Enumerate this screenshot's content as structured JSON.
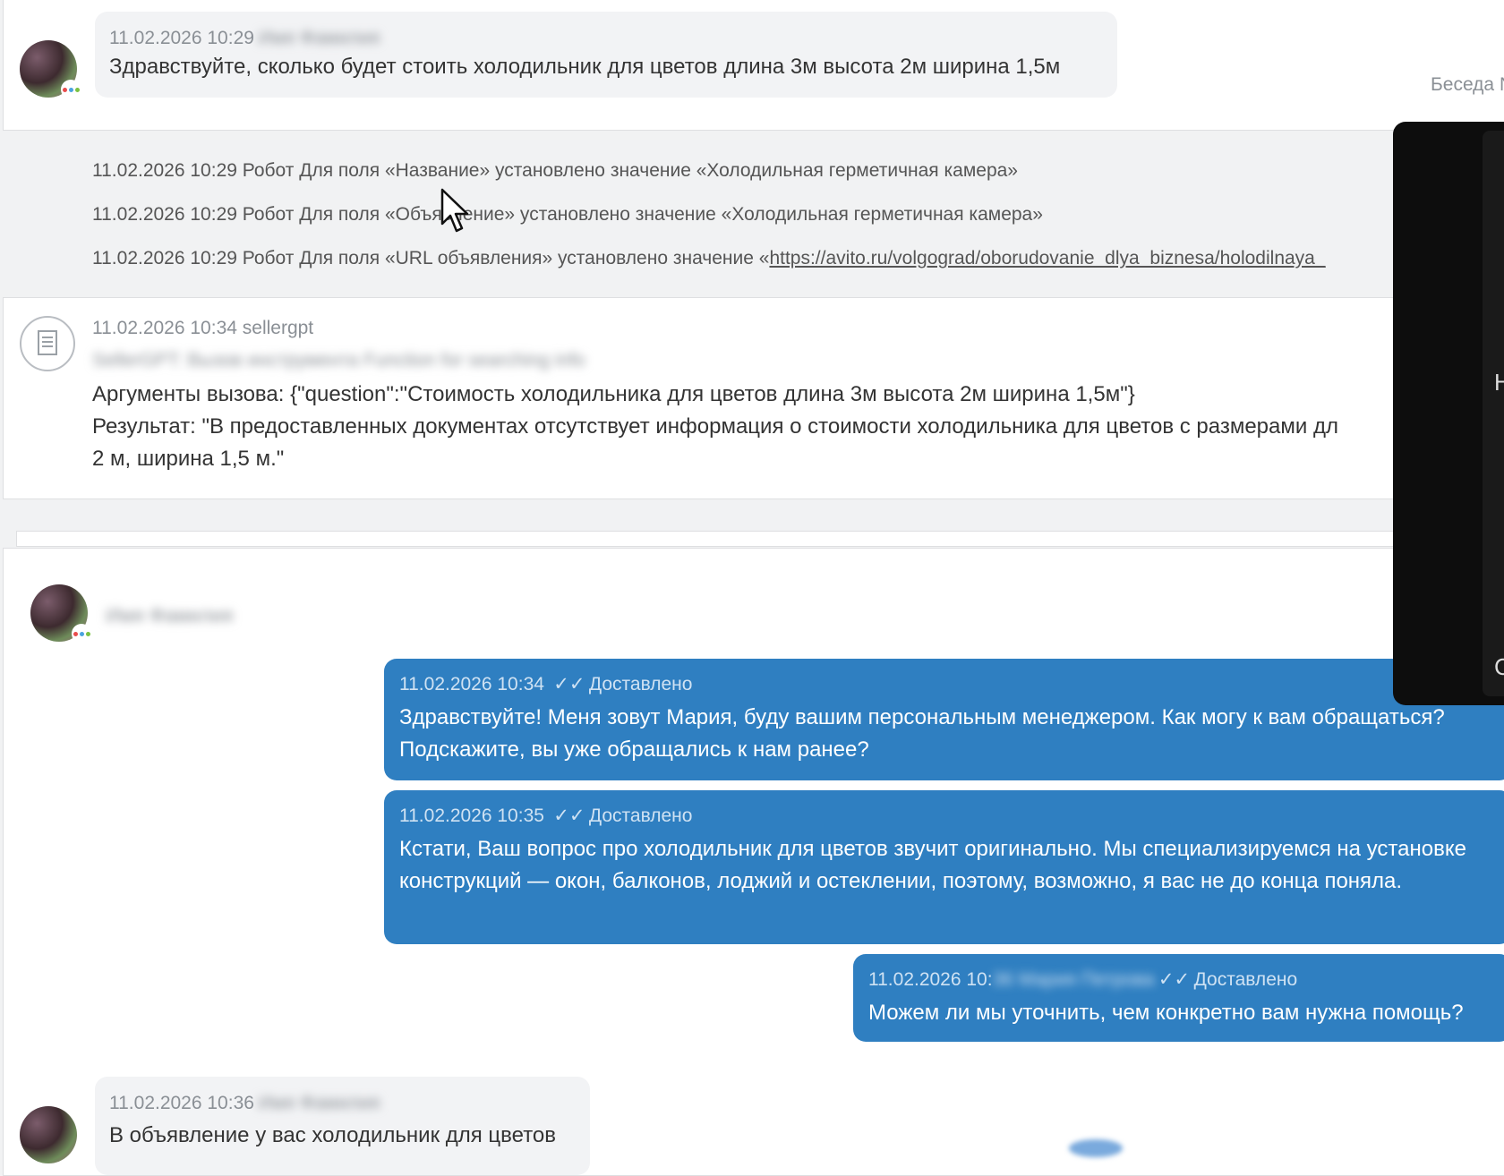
{
  "conversation_label": "Беседа N",
  "messages": [
    {
      "time": "11.02.2026 10:29",
      "author": "Имя Фамилия",
      "text": "Здравствуйте, сколько будет стоить холодильник для цветов длина 3м высота 2м ширина 1,5м"
    },
    {
      "time": "11.02.2026 10:36",
      "author": "Имя Фамилия",
      "text": "В объявление у вас холодильник для цветов"
    }
  ],
  "robot_log": [
    {
      "prefix": "11.02.2026 10:29 Робот Для поля «Название» установлено значение «Холодильная герметичная камера»"
    },
    {
      "prefix": "11.02.2026 10:29 Робот Для поля «Объявление» установлено значение «Холодильная герметичная камера»"
    },
    {
      "prefix": "11.02.2026 10:29 Робот Для поля «URL объявления» установлено значение «",
      "link": "https://avito.ru/volgograd/oborudovanie_dlya_biznesa/holodilnaya_"
    }
  ],
  "gpt_call": {
    "time": "11.02.2026 10:34 sellergpt",
    "title": "SellerGPT: Вызов инструмента Function for searching info",
    "arguments": "Аргументы вызова: {\"question\":\"Стоимость холодильника для цветов длина 3м высота 2м ширина 1,5м\"}",
    "result_line1": "Результат: \"В предоставленных документах отсутствует информация о стоимости холодильника для цветов с размерами дл",
    "result_line2": "2 м, ширина 1,5 м.\""
  },
  "chat_header": {
    "contact_name": "Имя Фамилия"
  },
  "outgoing": [
    {
      "time": "11.02.2026 10:34",
      "status": "Доставлено",
      "text": "Здравствуйте! Меня зовут Мария, буду вашим персональным менеджером. Как могу к вам обращаться? Подскажите, вы уже обращались к нам ранее?"
    },
    {
      "time": "11.02.2026 10:35",
      "status": "Доставлено",
      "text": "Кстати, Ваш вопрос про холодильник для цветов звучит оригинально. Мы специализируемся на установке конструкций — окон, балконов, лоджий и остеклении, поэтому, возможно, я вас не до конца поняла."
    },
    {
      "time": "11.02.2026 10:",
      "hidden": "36 Мария Петрова",
      "status": "Доставлено",
      "text": "Можем ли мы уточнить, чем конкретно вам нужна помощь?"
    }
  ],
  "overlay": {
    "glyph_top": "Н",
    "glyph_bottom": "С"
  }
}
